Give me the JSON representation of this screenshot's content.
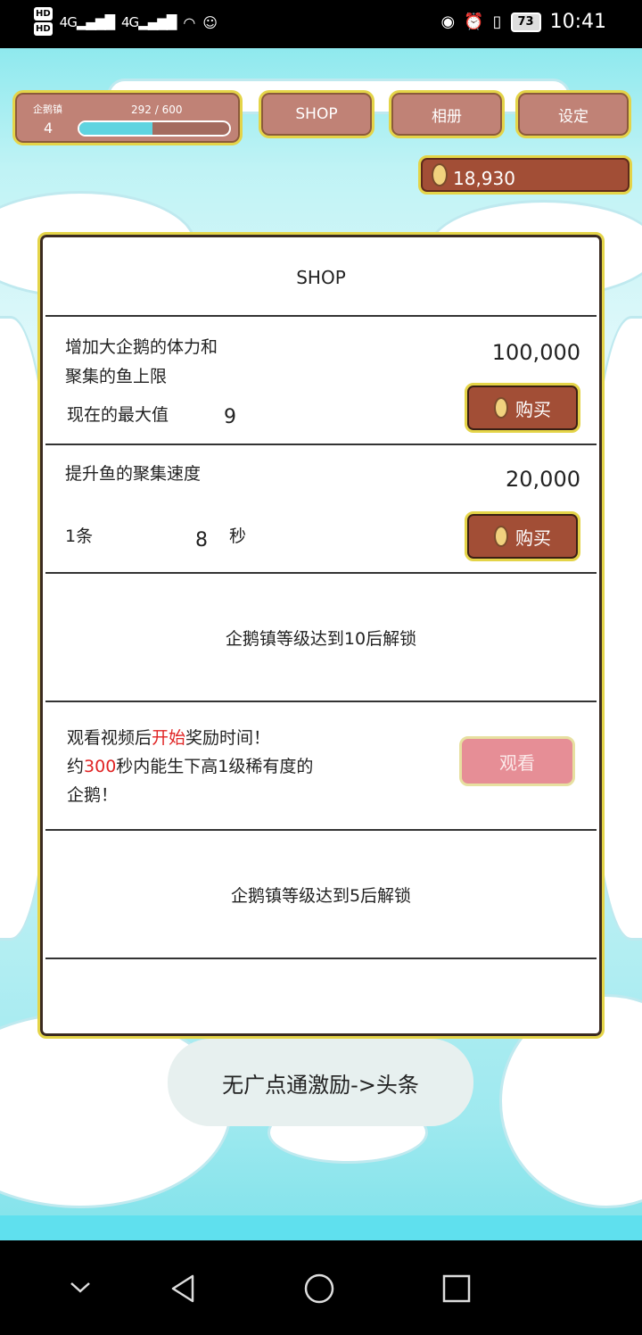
{
  "status_bar": {
    "hd1": "HD",
    "hd2": "HD",
    "sim1": "4G",
    "sim2": "4G",
    "battery": "73",
    "time": "10:41"
  },
  "hud": {
    "town_label": "企鹅镇",
    "town_level": "4",
    "progress_text": "292 / 600",
    "progress_fraction": 0.487,
    "shop_label": "SHOP",
    "album_label": "相册",
    "settings_label": "设定",
    "coins": "18,930"
  },
  "shop": {
    "title": "SHOP",
    "items": [
      {
        "desc_line1": "增加大企鹅的体力和",
        "desc_line2": "聚集的鱼上限",
        "stat_label": "现在的最大值",
        "stat_value": "9",
        "price": "100,000",
        "buy_label": "购买"
      },
      {
        "desc_line1": "提升鱼的聚集速度",
        "stat_label": "1条",
        "stat_value": "8",
        "stat_unit": "秒",
        "price": "20,000",
        "buy_label": "购买"
      }
    ],
    "lock1": "企鹅镇等级达到10后解锁",
    "video": {
      "line1_a": "观看视频后",
      "line1_b": "开始",
      "line1_c": "奖励时间！",
      "line2_a": "约",
      "line2_b": "300",
      "line2_c": "秒内能生下高1级稀有度的",
      "line3": "企鹅！",
      "watch_label": "观看"
    },
    "lock2": "企鹅镇等级达到5后解锁"
  },
  "toast": "无广点通激励->头条"
}
